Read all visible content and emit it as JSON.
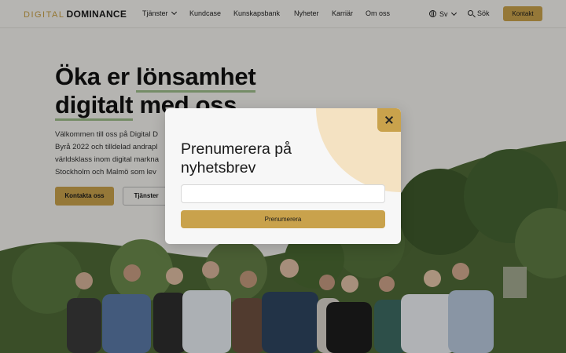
{
  "header": {
    "logo_part1": "DIGITAL",
    "logo_part2": "DOMINANCE",
    "nav": {
      "services": "Tjänster",
      "cases": "Kundcase",
      "knowledge": "Kunskapsbank",
      "news": "Nyheter",
      "career": "Karriär",
      "about": "Om oss"
    },
    "language": "Sv",
    "search": "Sök",
    "contact": "Kontakt"
  },
  "hero": {
    "title_line1_a": "Öka er ",
    "title_line1_b": "lönsamhet",
    "title_line2_a": "digitalt",
    "title_line2_b": " med oss",
    "text_lines": [
      "Välkommen till oss på Digital D",
      "Byrå 2022 och tilldelad andrapl",
      "världsklass inom digital markna",
      "Stockholm och Malmö som lev"
    ],
    "primary_button": "Kontakta oss",
    "secondary_button": "Tjänster"
  },
  "modal": {
    "title": "Prenumerera på nyhetsbrev",
    "email_value": "",
    "email_placeholder": "",
    "submit": "Prenumerera"
  },
  "colors": {
    "accent": "#c9a24c",
    "underline": "#9ebd8b",
    "modal_deco": "#f4e2c2"
  }
}
